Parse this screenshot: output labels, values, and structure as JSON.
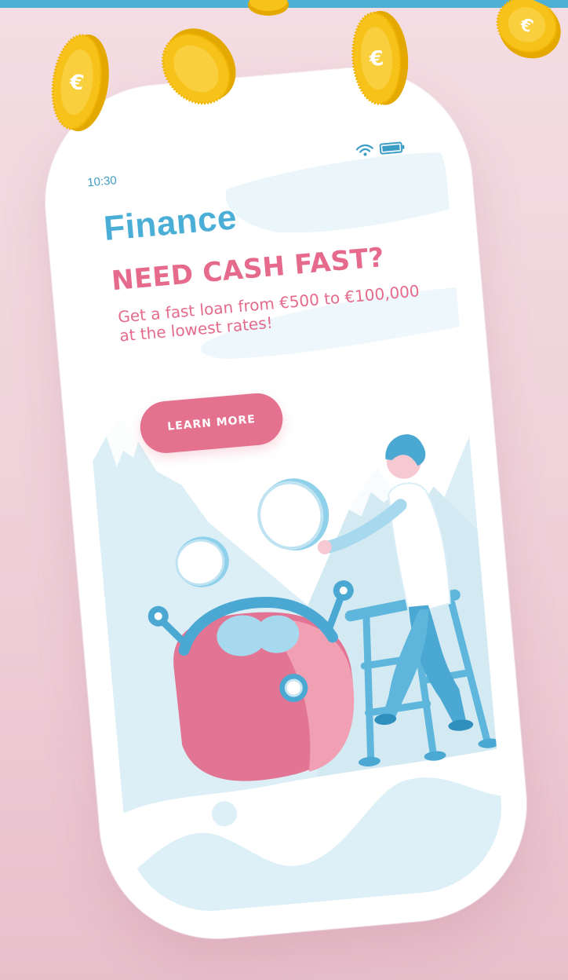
{
  "status_bar": {
    "time": "10:30",
    "icons": [
      "wifi-icon",
      "battery-icon"
    ]
  },
  "app": {
    "title": "Finance"
  },
  "promo": {
    "headline": "NEED CASH FAST?",
    "subheadline": "Get a fast loan from €500 to €100,000 at the lowest rates!",
    "cta_label": "LEARN MORE"
  },
  "decor": {
    "coin_symbol": "€",
    "illustration": [
      "purse-illustration",
      "person-on-ladder-illustration",
      "coin-illustration",
      "mountain-illustration"
    ]
  },
  "colors": {
    "accent_blue": "#4aaed6",
    "accent_pink": "#e56a8c",
    "button_pink": "#e4728f",
    "coin_gold": "#f7c21a",
    "light_blue_bg": "#ddf0f7",
    "page_bg": "#f0d4dc"
  }
}
